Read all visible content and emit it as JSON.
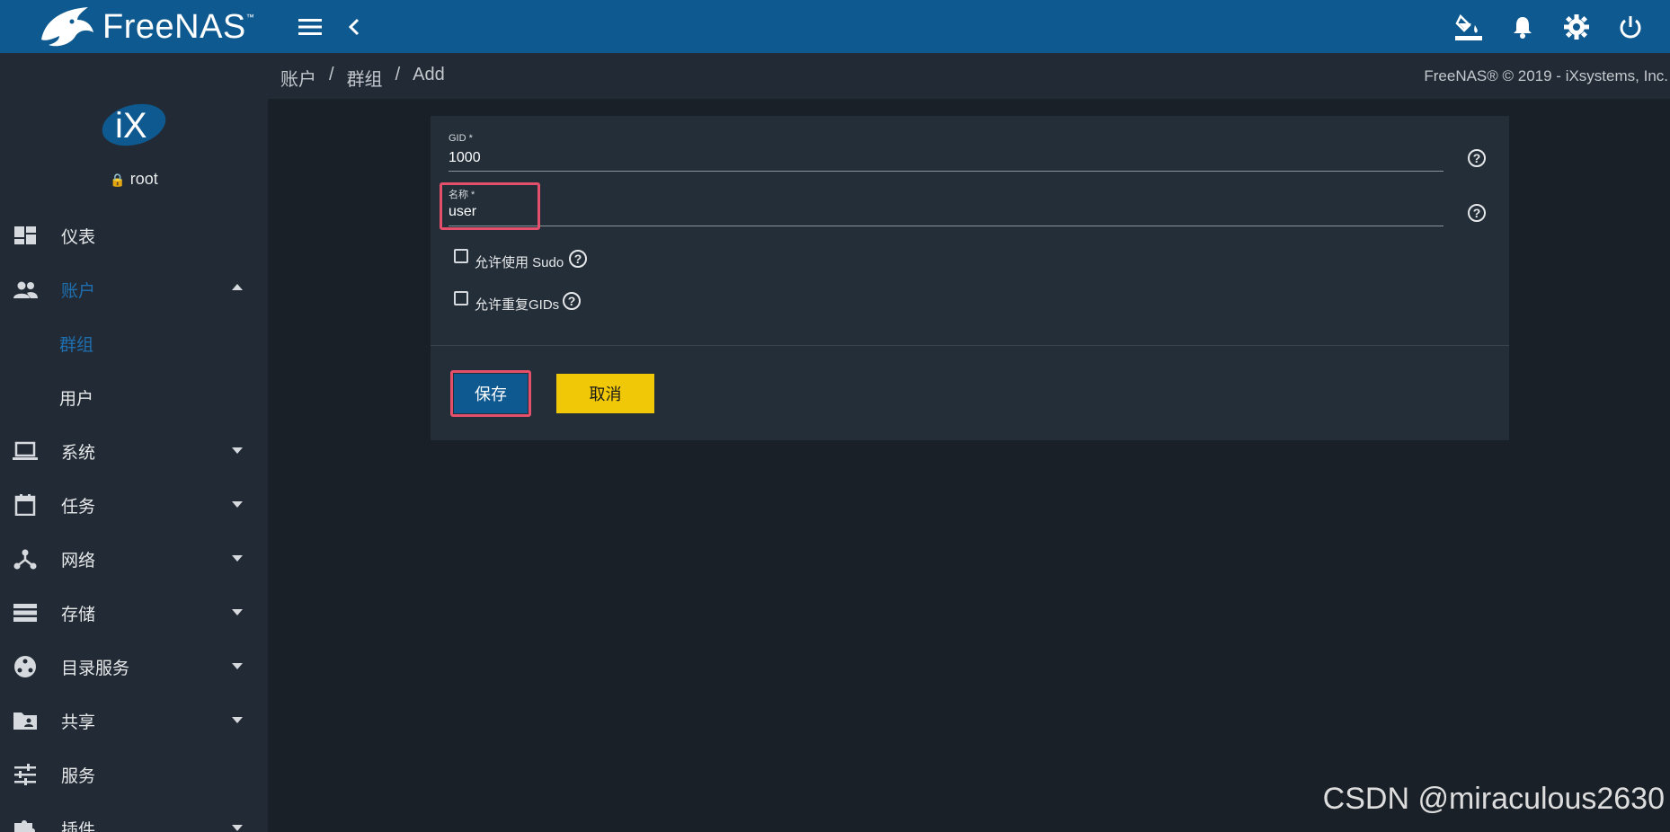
{
  "app": {
    "brand": "FreeNAS",
    "brand_tm": "™"
  },
  "toolbar": {
    "menu_icon": "menu-icon",
    "back_icon": "chevron-left-icon",
    "theme_icon": "paint-bucket-icon",
    "notifications_icon": "bell-icon",
    "settings_icon": "gear-icon",
    "power_icon": "power-icon"
  },
  "sidebar": {
    "user": "root",
    "items": [
      {
        "label": "仪表",
        "icon": "dashboard-icon"
      },
      {
        "label": "账户",
        "icon": "people-icon",
        "expanded": true
      },
      {
        "label": "群组",
        "sub": true,
        "active": true
      },
      {
        "label": "用户",
        "sub": true
      },
      {
        "label": "系统",
        "icon": "laptop-icon"
      },
      {
        "label": "任务",
        "icon": "calendar-icon"
      },
      {
        "label": "网络",
        "icon": "network-icon"
      },
      {
        "label": "存储",
        "icon": "storage-icon"
      },
      {
        "label": "目录服务",
        "icon": "directory-icon"
      },
      {
        "label": "共享",
        "icon": "folder-shared-icon"
      },
      {
        "label": "服务",
        "icon": "tune-icon"
      },
      {
        "label": "插件",
        "icon": "puzzle-icon"
      }
    ]
  },
  "breadcrumb": {
    "items": [
      "账户",
      "群组",
      "Add"
    ],
    "separator": "/"
  },
  "copyright": "FreeNAS® © 2019 - iXsystems, Inc.",
  "form": {
    "gid_label": "GID *",
    "gid_value": "1000",
    "name_label": "名称 *",
    "name_value": "user",
    "sudo_label": "允许使用 Sudo",
    "dup_gid_label": "允许重复GIDs",
    "save_label": "保存",
    "cancel_label": "取消"
  },
  "colors": {
    "topbar": "#0e598f",
    "save_button": "#0e598f",
    "cancel_button": "#f0c808",
    "highlight": "#e4506b",
    "active_nav": "#1f6fb0"
  },
  "watermark": "CSDN @miraculous2630"
}
